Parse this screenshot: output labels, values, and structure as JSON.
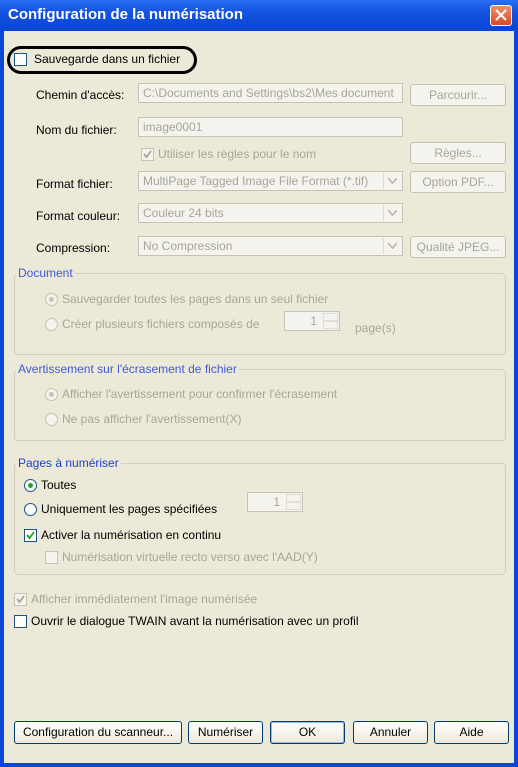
{
  "window": {
    "title": "Configuration de la numérisation"
  },
  "save_to_file": {
    "label": "Sauvegarde dans un fichier",
    "checked": false
  },
  "path": {
    "label": "Chemin d'accès:",
    "value": "C:\\Documents and Settings\\bs2\\Mes document",
    "browse_label": "Parcourir..."
  },
  "filename": {
    "label": "Nom du fichier:",
    "value": "image0001"
  },
  "use_rules": {
    "label": "Utiliser les règles pour le nom",
    "checked": true,
    "rules_label": "Règles..."
  },
  "file_format": {
    "label": "Format fichier:",
    "value": "MultiPage Tagged Image File Format (*.tif)",
    "options_label": "Option PDF..."
  },
  "color_format": {
    "label": "Format couleur:",
    "value": "Couleur 24 bits"
  },
  "compression": {
    "label": "Compression:",
    "value": "No Compression",
    "jpeg_label": "Qualité JPEG..."
  },
  "document": {
    "title": "Document",
    "opt_single": "Sauvegarder toutes les pages dans un seul fichier",
    "opt_multi": "Créer plusieurs fichiers composés de",
    "pages_value": "1",
    "pages_unit": "page(s)"
  },
  "overwrite": {
    "title": "Avertissement sur l'écrasement de fichier",
    "opt_show": "Afficher l'avertissement pour confirmer l'écrasement",
    "opt_hide": "Ne pas afficher l'avertissement(X)"
  },
  "pages": {
    "title": "Pages à numériser",
    "opt_all": "Toutes",
    "opt_specified": "Uniquement les pages spécifiées",
    "spec_value": "1",
    "continuous_label": "Activer la numérisation en continu",
    "virtual_duplex_label": "Numérisation virtuelle recto verso avec l'AAD(Y)"
  },
  "show_image": {
    "label": "Afficher immédiatement l'image numérisée",
    "checked": true
  },
  "twain_dialog": {
    "label": "Ouvrir le dialogue TWAIN avant la numérisation avec un profil",
    "checked": false
  },
  "buttons": {
    "scanner_config": "Configuration du scanneur...",
    "scan": "Numériser",
    "ok": "OK",
    "cancel": "Annuler",
    "help": "Aide"
  }
}
